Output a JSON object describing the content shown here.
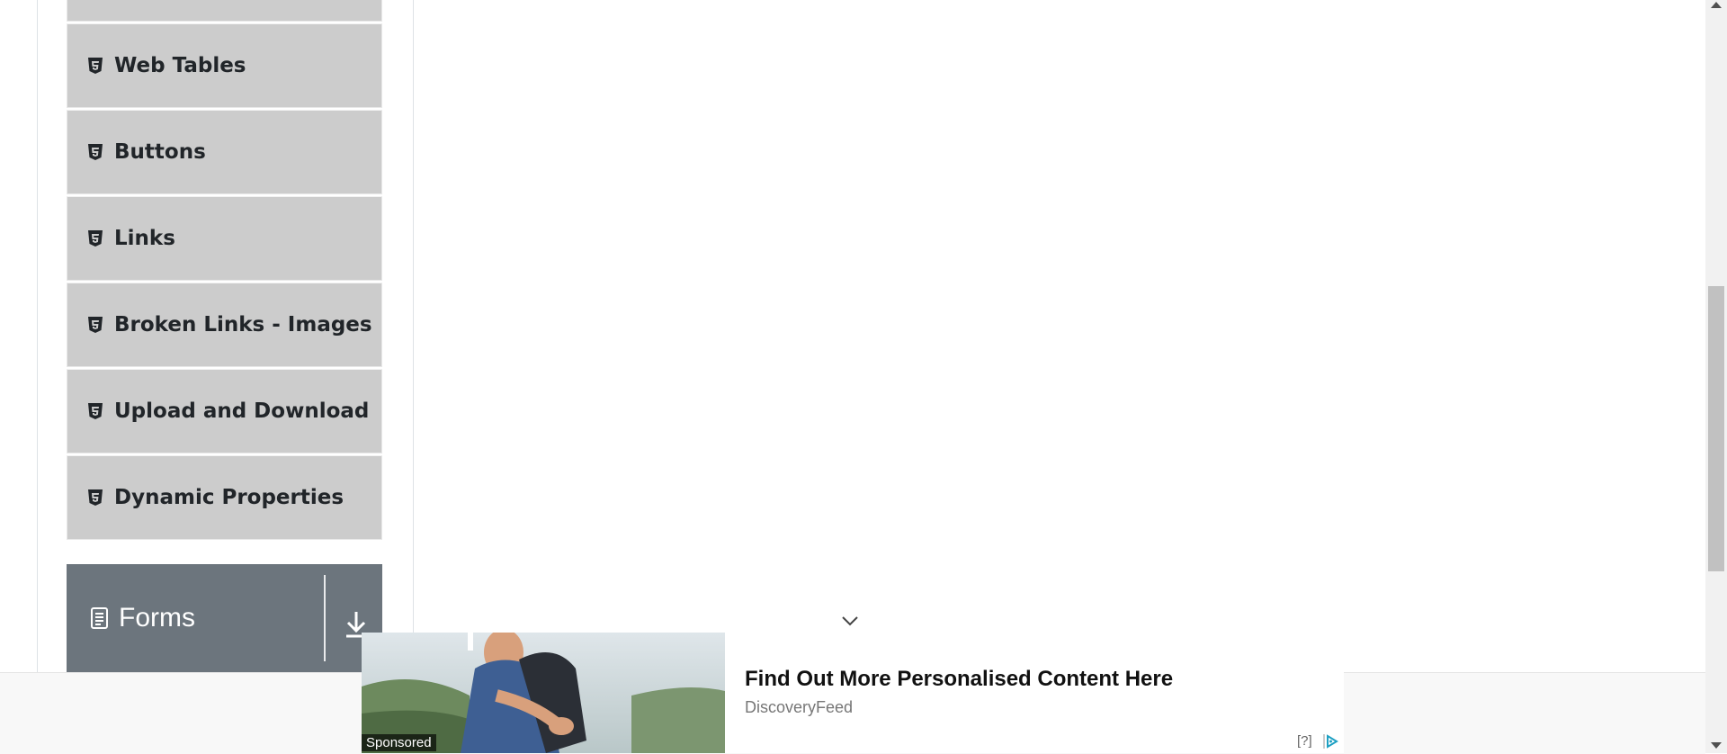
{
  "sidebar": {
    "items": [
      {
        "label": "",
        "icon": "html5-icon"
      },
      {
        "label": "Web Tables",
        "icon": "html5-icon"
      },
      {
        "label": "Buttons",
        "icon": "html5-icon"
      },
      {
        "label": "Links",
        "icon": "html5-icon"
      },
      {
        "label": "Broken Links - Images",
        "icon": "html5-icon"
      },
      {
        "label": "Upload and Download",
        "icon": "html5-icon"
      },
      {
        "label": "Dynamic Properties",
        "icon": "html5-icon"
      }
    ],
    "group": {
      "title": "Forms",
      "icon": "document-icon",
      "toggle_icon": "arrow-down-icon"
    }
  },
  "ad": {
    "sponsored_label": "Sponsored",
    "headline": "Find Out More Personalised Content Here",
    "source": "DiscoveryFeed",
    "help_label": "[?]",
    "choices_icon": "adchoices-icon"
  },
  "colors": {
    "menu_bg": "#cccccc",
    "group_bg": "#6c757d",
    "text_dark": "#212529"
  }
}
